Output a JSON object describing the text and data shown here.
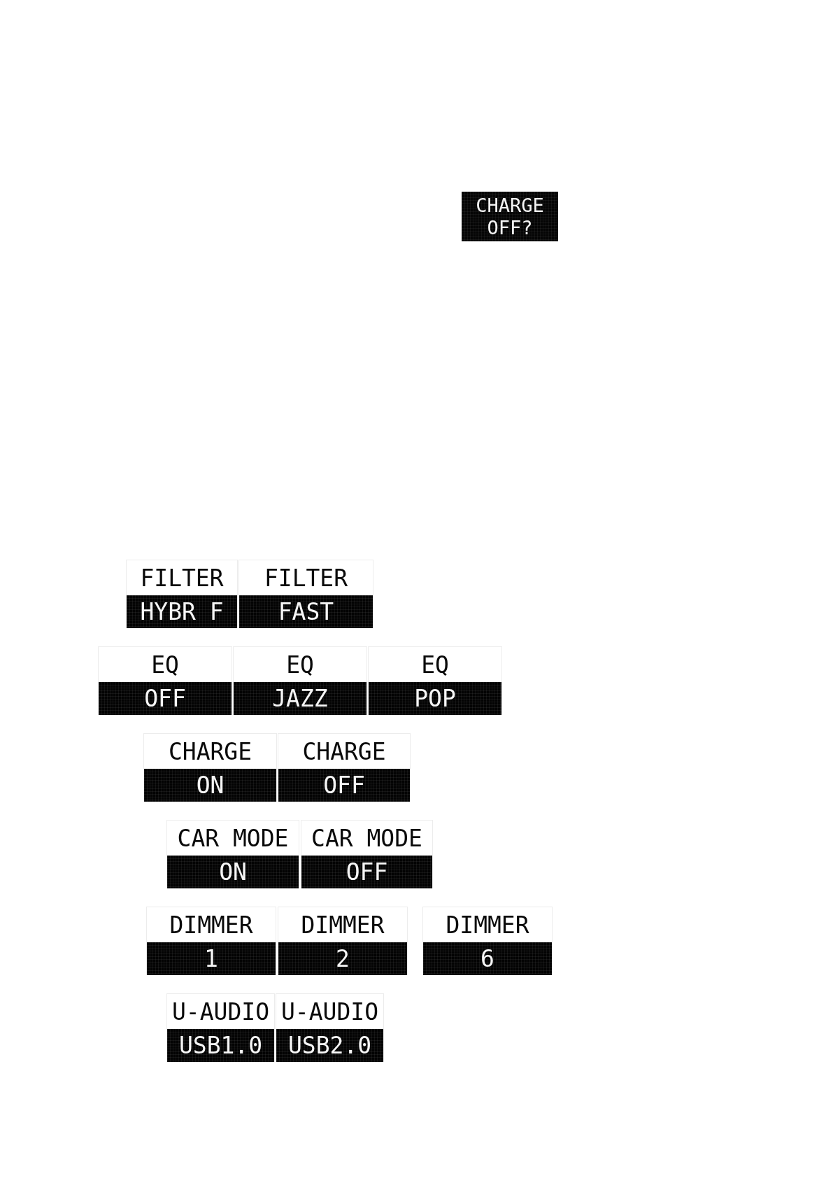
{
  "confirm_dialog": {
    "lines": [
      "CHARGE",
      "OFF?"
    ]
  },
  "setting_groups": [
    {
      "screens": [
        {
          "label": "FILTER",
          "value": "HYBR F"
        },
        {
          "label": "FILTER",
          "value": "FAST"
        }
      ]
    },
    {
      "screens": [
        {
          "label": "EQ",
          "value": "OFF"
        },
        {
          "label": "EQ",
          "value": "JAZZ"
        },
        {
          "label": "EQ",
          "value": "POP"
        }
      ]
    },
    {
      "screens": [
        {
          "label": "CHARGE",
          "value": "ON"
        },
        {
          "label": "CHARGE",
          "value": "OFF"
        }
      ]
    },
    {
      "screens": [
        {
          "label": "CAR MODE",
          "value": "ON"
        },
        {
          "label": "CAR MODE",
          "value": "OFF"
        }
      ]
    },
    {
      "screens": [
        {
          "label": "DIMMER",
          "value": "1"
        },
        {
          "label": "DIMMER",
          "value": "2"
        },
        {
          "label": "DIMMER",
          "value": "6"
        }
      ]
    },
    {
      "screens": [
        {
          "label": "U-AUDIO",
          "value": "USB1.0"
        },
        {
          "label": "U-AUDIO",
          "value": "USB2.0"
        }
      ]
    }
  ]
}
